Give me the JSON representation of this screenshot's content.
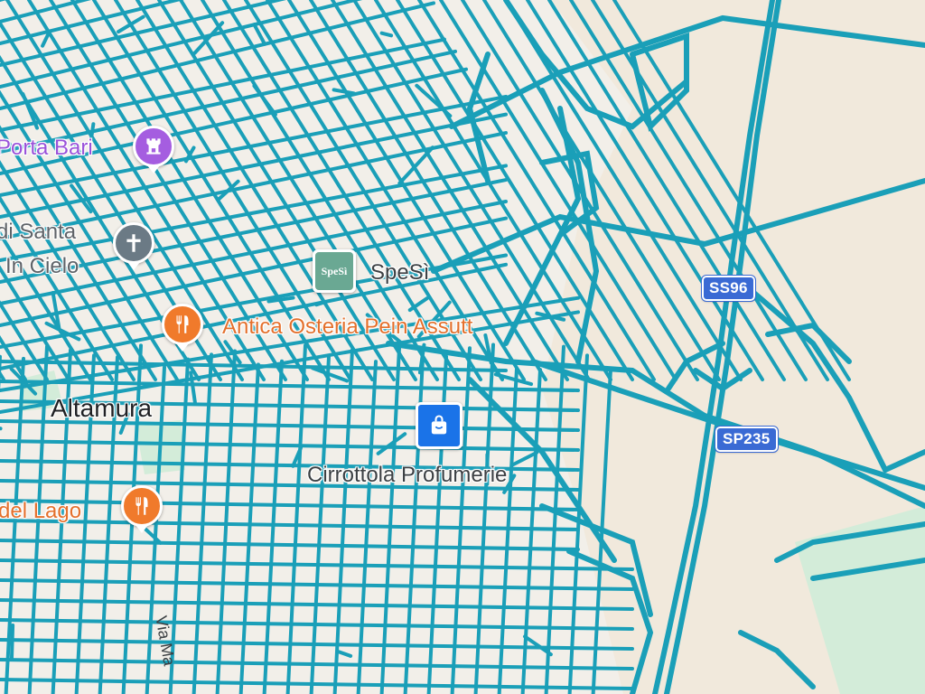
{
  "places": {
    "porta_bari": "Porta Bari",
    "santa_line1": "di Santa",
    "santa_line2": "In Cielo",
    "spesi": "SpeSì",
    "spesi_logo": "SpeSì",
    "osteria": "Antica Osteria Pein Assutt",
    "altamura": "Altamura",
    "profumerie": "Cirrottola Profumerie",
    "del_lago": "del Lago",
    "via_ma": "Via Ma"
  },
  "roads": {
    "ss96": "SS96",
    "sp235": "SP235"
  },
  "icons": {
    "porta_bari": "castle-icon",
    "church": "cross-icon",
    "restaurant": "fork-knife-icon",
    "shopping": "shopping-bag-icon",
    "store": "store-logo-icon"
  },
  "colors": {
    "land": "#f2efe9",
    "sand": "#f1e9dc",
    "park": "#d3ecd9",
    "road_overlay": "#1a9fb8",
    "road_casing": "#ffffff",
    "highway_shield": "#3a6ad4",
    "poi_purple": "#a55de0",
    "poi_gray": "#6b7a85",
    "poi_orange": "#f07a2b",
    "poi_blue": "#1a73e8",
    "poi_teal": "#6aa893"
  }
}
